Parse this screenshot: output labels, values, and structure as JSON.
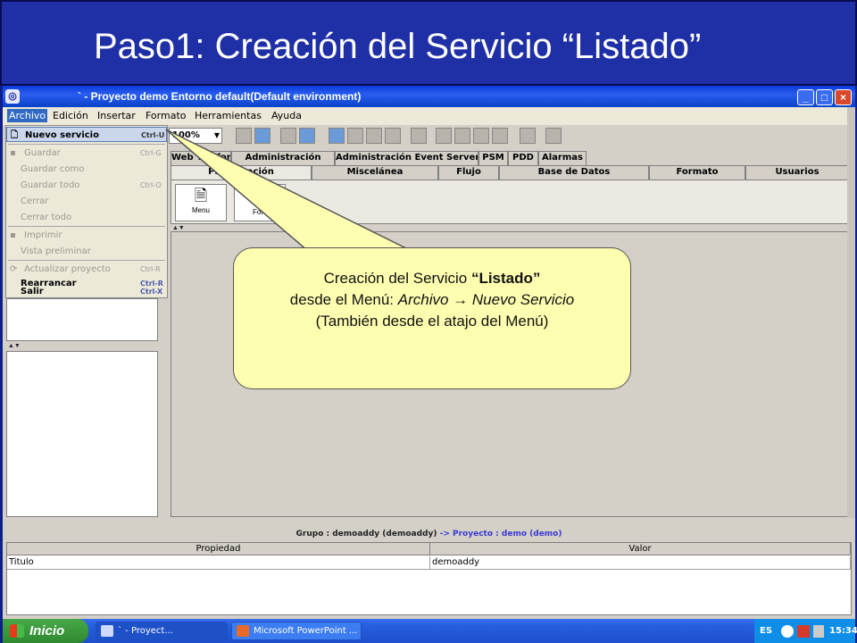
{
  "slide": {
    "title": "Paso1: Creación del Servicio “Listado”"
  },
  "window": {
    "title": "` - Proyecto demo Entorno default(Default environment)",
    "buttons": {
      "minimize": "_",
      "maximize": "□",
      "close": "×"
    }
  },
  "menubar": [
    "Archivo",
    "Edición",
    "Insertar",
    "Formato",
    "Herramientas",
    "Ayuda"
  ],
  "toolbar": {
    "zoom": "100%"
  },
  "file_menu": {
    "items": [
      {
        "label": "Nuevo servicio",
        "shortcut": "Ctrl-U",
        "state": "highlighted"
      },
      {
        "label": "Guardar",
        "shortcut": "Ctrl-G",
        "state": "disabled"
      },
      {
        "label": "Guardar como",
        "shortcut": "",
        "state": "disabled"
      },
      {
        "label": "Guardar todo",
        "shortcut": "Ctrl-O",
        "state": "disabled"
      },
      {
        "label": "Cerrar",
        "shortcut": "",
        "state": "disabled"
      },
      {
        "label": "Cerrar todo",
        "shortcut": "",
        "state": "disabled"
      },
      {
        "label": "Imprimir",
        "shortcut": "",
        "state": "disabled"
      },
      {
        "label": "Vista preliminar",
        "shortcut": "",
        "state": "disabled"
      },
      {
        "label": "Actualizar proyecto",
        "shortcut": "Ctrl-R",
        "state": "disabled"
      },
      {
        "label": "Rearrancar",
        "shortcut": "Ctrl-R",
        "state": "enabled"
      },
      {
        "label": "Salir",
        "shortcut": "Ctrl-X",
        "state": "enabled"
      }
    ]
  },
  "tabs_top": [
    "Web Telefonía",
    "Administración",
    "Administración Event Server",
    "PSM",
    "PDD",
    "Alarmas"
  ],
  "tabs_bottom": [
    "Presentación",
    "Miscelánea",
    "Flujo",
    "Base de Datos",
    "Formato",
    "Usuarios"
  ],
  "palette": {
    "menu_label": "Menu",
    "form_label": "For"
  },
  "properties": {
    "group_text": "Grupo : demoaddy (demoaddy)",
    "project_text": "-> Proyecto : demo (demo)",
    "headers": [
      "Propiedad",
      "Valor"
    ],
    "rows": [
      {
        "property": "Titulo",
        "value": "demoaddy"
      }
    ]
  },
  "taskbar": {
    "start": "Inicio",
    "buttons": [
      "` - Proyect...",
      "Microsoft PowerPoint ..."
    ],
    "lang": "ES",
    "clock": "15:34"
  },
  "callout": {
    "line1_prefix": "Creación del Servicio ",
    "line1_bold": "“Listado”",
    "line2_prefix": "desde el Menú: ",
    "line2_italic_a": "Archivo",
    "line2_arrow": " → ",
    "line2_italic_b": "Nuevo Servicio",
    "line3": "(También desde el atajo del Menú)"
  },
  "colors": {
    "slide_bg": "#1f2fa6",
    "callout_bg": "#fefeb0",
    "menu_highlight": "#c9d6ec"
  }
}
